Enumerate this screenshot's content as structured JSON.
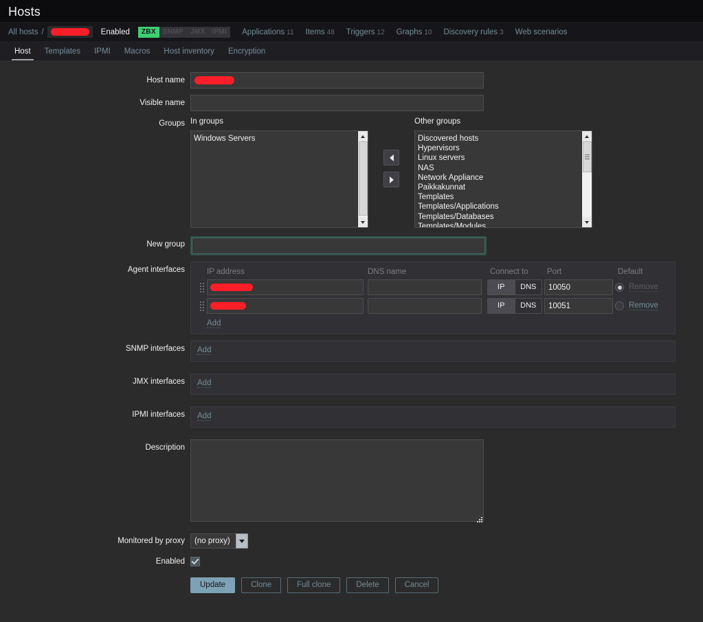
{
  "header": {
    "title": "Hosts"
  },
  "breadcrumb": {
    "all_hosts": "All hosts",
    "separator": "/",
    "host_redacted": true,
    "status": "Enabled",
    "interface_badges": [
      {
        "label": "ZBX",
        "state": "on"
      },
      {
        "label": "SNMP",
        "state": "off"
      },
      {
        "label": "JMX",
        "state": "off"
      },
      {
        "label": "IPMI",
        "state": "off"
      }
    ],
    "items": [
      {
        "label": "Applications",
        "count": "11"
      },
      {
        "label": "Items",
        "count": "48"
      },
      {
        "label": "Triggers",
        "count": "12"
      },
      {
        "label": "Graphs",
        "count": "10"
      },
      {
        "label": "Discovery rules",
        "count": "3"
      },
      {
        "label": "Web scenarios",
        "count": ""
      }
    ]
  },
  "tabs": [
    {
      "label": "Host",
      "active": true
    },
    {
      "label": "Templates",
      "active": false
    },
    {
      "label": "IPMI",
      "active": false
    },
    {
      "label": "Macros",
      "active": false
    },
    {
      "label": "Host inventory",
      "active": false
    },
    {
      "label": "Encryption",
      "active": false
    }
  ],
  "form": {
    "host_name": {
      "label": "Host name",
      "value": "",
      "placeholder": "",
      "redacted": true
    },
    "visible_name": {
      "label": "Visible name",
      "value": "",
      "placeholder": ""
    },
    "groups": {
      "label": "Groups",
      "in_groups_header": "In groups",
      "other_groups_header": "Other groups",
      "in_groups": [
        "Windows Servers"
      ],
      "other_groups": [
        "Discovered hosts",
        "Hypervisors",
        "Linux servers",
        "NAS",
        "Network Appliance",
        "Paikkakunnat",
        "Templates",
        "Templates/Applications",
        "Templates/Databases",
        "Templates/Modules"
      ],
      "move_left_icon": "triangle-left-icon",
      "move_right_icon": "triangle-right-icon"
    },
    "new_group": {
      "label": "New group",
      "value": "",
      "placeholder": ""
    },
    "agent_interfaces": {
      "label": "Agent interfaces",
      "columns": {
        "ip": "IP address",
        "dns": "DNS name",
        "connect_to": "Connect to",
        "port": "Port",
        "default": "Default"
      },
      "rows": [
        {
          "ip_redacted": true,
          "ip": "",
          "dns": "",
          "connect_to": "IP",
          "connect_options": [
            "IP",
            "DNS"
          ],
          "port": "10050",
          "is_default": true,
          "remove_label": "Remove",
          "remove_enabled": false
        },
        {
          "ip_redacted": true,
          "ip": "",
          "dns": "",
          "connect_to": "IP",
          "connect_options": [
            "IP",
            "DNS"
          ],
          "port": "10051",
          "is_default": false,
          "remove_label": "Remove",
          "remove_enabled": true
        }
      ],
      "add_label": "Add"
    },
    "snmp_interfaces": {
      "label": "SNMP interfaces",
      "add_label": "Add"
    },
    "jmx_interfaces": {
      "label": "JMX interfaces",
      "add_label": "Add"
    },
    "ipmi_interfaces": {
      "label": "IPMI interfaces",
      "add_label": "Add"
    },
    "description": {
      "label": "Description",
      "value": "",
      "placeholder": ""
    },
    "monitored_by_proxy": {
      "label": "Monitored by proxy",
      "value": "(no proxy)",
      "options": [
        "(no proxy)"
      ]
    },
    "enabled": {
      "label": "Enabled",
      "checked": true
    }
  },
  "buttons": [
    {
      "label": "Update",
      "style": "primary"
    },
    {
      "label": "Clone",
      "style": "ghost"
    },
    {
      "label": "Full clone",
      "style": "ghost"
    },
    {
      "label": "Delete",
      "style": "ghost"
    },
    {
      "label": "Cancel",
      "style": "ghost"
    }
  ],
  "colors": {
    "page_bg": "#2b2b2b",
    "header_bg": "#0c0c0e",
    "breadcrumb_bg": "#16161a",
    "tabs_bg": "#1f1f23",
    "link": "#768d99",
    "badge_on": "#3dcf70",
    "primary_button": "#7ea2b5",
    "redaction": "#fa1e28",
    "focus_ring": "#31534c"
  }
}
